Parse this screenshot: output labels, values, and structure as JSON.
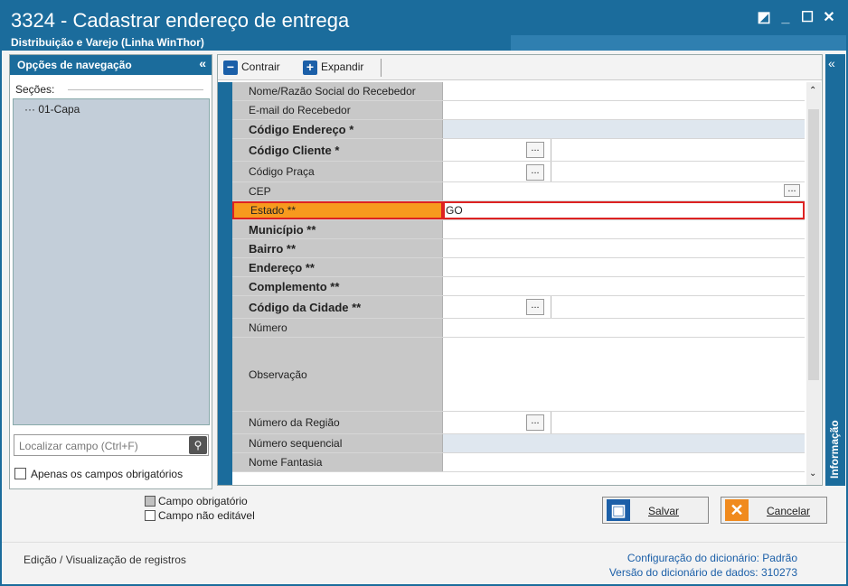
{
  "window": {
    "title": "3324 - Cadastrar endereço de entrega",
    "subtitle": "Distribuição e Varejo (Linha WinThor)",
    "controls": [
      "restore-icon",
      "minimize-icon",
      "maximize-icon",
      "close-icon"
    ]
  },
  "nav": {
    "header": "Opções de navegação",
    "collapse": "«",
    "sections_label": "Seções:",
    "tree_items": [
      "01-Capa"
    ],
    "search_placeholder": "Localizar campo (Ctrl+F)",
    "only_required_label": "Apenas os campos obrigatórios"
  },
  "toolbar": {
    "collapse_label": "Contrair",
    "expand_label": "Expandir"
  },
  "fields": [
    {
      "label": "Nome/Razão Social do Recebedor",
      "bold": false,
      "value": "",
      "editable": true
    },
    {
      "label": "E-mail do Recebedor",
      "bold": false,
      "value": "",
      "editable": true
    },
    {
      "label": "Código Endereço *",
      "bold": true,
      "value": "",
      "editable": false
    },
    {
      "label": "Código Cliente  *",
      "bold": true,
      "value": "",
      "editable": true,
      "lookup": true
    },
    {
      "label": "Código Praça",
      "bold": false,
      "value": "",
      "editable": true,
      "lookup": true
    },
    {
      "label": "CEP",
      "bold": false,
      "value": "",
      "editable": true,
      "lookup_right": true
    },
    {
      "label": "Estado **",
      "bold": false,
      "value": "GO",
      "editable": true,
      "selected": true
    },
    {
      "label": "Município **",
      "bold": true,
      "value": "",
      "editable": true
    },
    {
      "label": "Bairro **",
      "bold": true,
      "value": "",
      "editable": true
    },
    {
      "label": "Endereço **",
      "bold": true,
      "value": "",
      "editable": true
    },
    {
      "label": "Complemento **",
      "bold": true,
      "value": "",
      "editable": true
    },
    {
      "label": "Código da Cidade **",
      "bold": true,
      "value": "",
      "editable": true,
      "lookup": true
    },
    {
      "label": "Número",
      "bold": false,
      "value": "",
      "editable": true
    },
    {
      "label": "Observação",
      "bold": false,
      "value": "",
      "editable": true
    },
    {
      "label": "Número da Região",
      "bold": false,
      "value": "",
      "editable": true,
      "lookup": true
    },
    {
      "label": "Número sequencial",
      "bold": false,
      "value": "",
      "editable": false
    },
    {
      "label": "Nome Fantasia",
      "bold": false,
      "value": "",
      "editable": true
    }
  ],
  "info_panel": {
    "label": "Informação",
    "collapse": "«"
  },
  "legend": {
    "required": "Campo obrigatório",
    "not_editable": "Campo não editável"
  },
  "buttons": {
    "save": "Salvar",
    "cancel": "Cancelar"
  },
  "footer": {
    "left": "Edição / Visualização de registros",
    "dict_config": "Configuração do dicionário: Padrão",
    "dict_version": "Versão do dicionário de dados: 310273"
  },
  "colors": {
    "accent": "#1b6c9c",
    "selected_label": "#f79a1e",
    "selected_border": "#dd2222",
    "save_icon": "#1b5fa8",
    "cancel_icon": "#f08a1e"
  }
}
